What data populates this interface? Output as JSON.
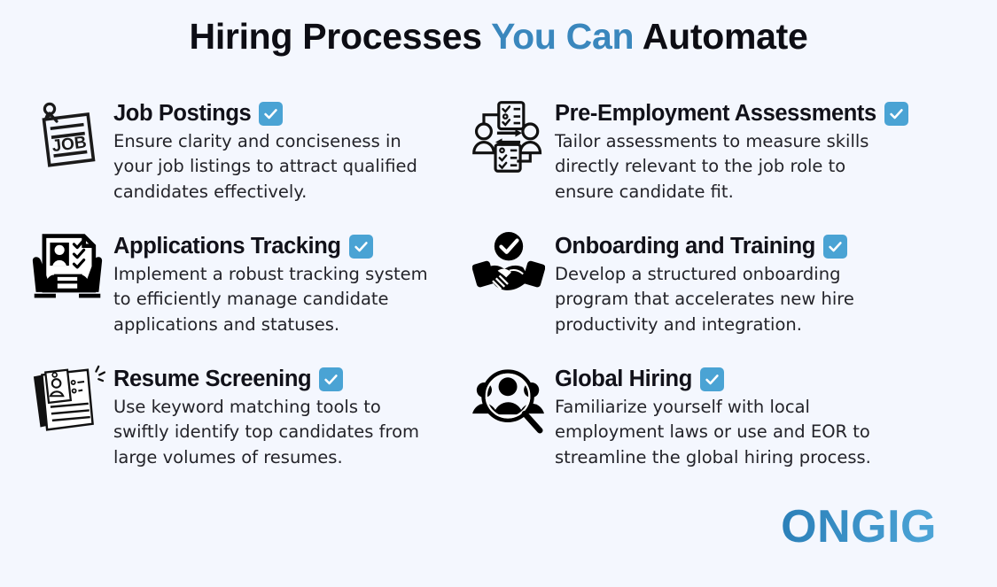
{
  "title": {
    "part1": "Hiring Processes ",
    "accent": "You Can",
    "part2": " Automate",
    "accent_color": "#3a87bd",
    "text_color": "#0d0d14"
  },
  "theme": {
    "background": "#f4f7fe",
    "check_badge_color": "#4aa3d4",
    "body_text_color": "#232329",
    "icon_color": "#111111"
  },
  "items": [
    {
      "id": "job-postings",
      "column": "left",
      "icon": "job-posting-note-icon",
      "title": "Job Postings",
      "badge": "check-badge",
      "description": "Ensure clarity and conciseness in your job listings to attract qualified candidates effectively."
    },
    {
      "id": "pre-employment-assessments",
      "column": "right",
      "icon": "assessment-exchange-icon",
      "title": "Pre-Employment Assessments",
      "badge": "check-badge",
      "description": "Tailor assessments to measure skills directly relevant to the job role to ensure candidate fit."
    },
    {
      "id": "applications-tracking",
      "column": "left",
      "icon": "hands-holding-resume-icon",
      "title": "Applications Tracking",
      "badge": "check-badge",
      "description": "Implement a robust tracking system to efficiently manage candidate applications and statuses."
    },
    {
      "id": "onboarding-and-training",
      "column": "right",
      "icon": "handshake-check-icon",
      "title": "Onboarding and Training",
      "badge": "check-badge",
      "description": "Develop a structured onboarding program that accelerates new hire productivity and integration."
    },
    {
      "id": "resume-screening",
      "column": "left",
      "icon": "stacked-resumes-sketch-icon",
      "title": "Resume Screening",
      "badge": "check-badge",
      "description": "Use keyword matching tools to swiftly identify top candidates from large volumes of resumes."
    },
    {
      "id": "global-hiring",
      "column": "right",
      "icon": "magnifier-people-icon",
      "title": "Global Hiring",
      "badge": "check-badge",
      "description": "Familiarize yourself with local employment laws or use and EOR to streamline the global hiring process."
    }
  ],
  "logo": {
    "text": "ONGIG",
    "gradient_start": "#2a7fb8",
    "gradient_end": "#4ea6d8"
  }
}
